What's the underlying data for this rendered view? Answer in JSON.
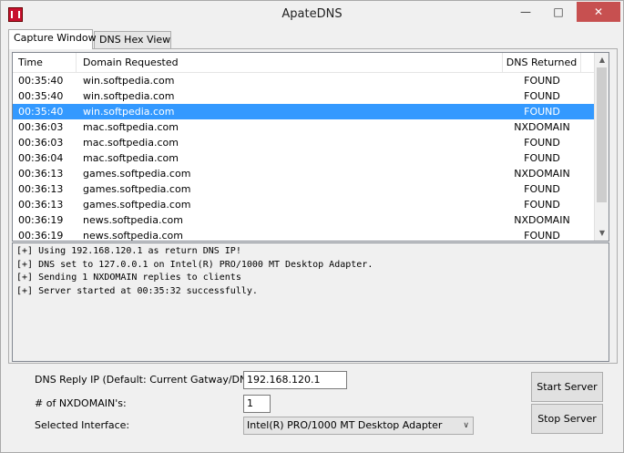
{
  "window": {
    "title": "ApateDNS"
  },
  "tabs": [
    {
      "label": "Capture Window",
      "active": true
    },
    {
      "label": "DNS Hex View",
      "active": false
    }
  ],
  "table": {
    "columns": [
      "Time",
      "Domain Requested",
      "DNS Returned"
    ],
    "rows": [
      {
        "time": "00:35:40",
        "domain": "win.softpedia.com",
        "returned": "FOUND",
        "selected": false
      },
      {
        "time": "00:35:40",
        "domain": "win.softpedia.com",
        "returned": "FOUND",
        "selected": false
      },
      {
        "time": "00:35:40",
        "domain": "win.softpedia.com",
        "returned": "FOUND",
        "selected": true
      },
      {
        "time": "00:36:03",
        "domain": "mac.softpedia.com",
        "returned": "NXDOMAIN",
        "selected": false
      },
      {
        "time": "00:36:03",
        "domain": "mac.softpedia.com",
        "returned": "FOUND",
        "selected": false
      },
      {
        "time": "00:36:04",
        "domain": "mac.softpedia.com",
        "returned": "FOUND",
        "selected": false
      },
      {
        "time": "00:36:13",
        "domain": "games.softpedia.com",
        "returned": "NXDOMAIN",
        "selected": false
      },
      {
        "time": "00:36:13",
        "domain": "games.softpedia.com",
        "returned": "FOUND",
        "selected": false
      },
      {
        "time": "00:36:13",
        "domain": "games.softpedia.com",
        "returned": "FOUND",
        "selected": false
      },
      {
        "time": "00:36:19",
        "domain": "news.softpedia.com",
        "returned": "NXDOMAIN",
        "selected": false
      },
      {
        "time": "00:36:19",
        "domain": "news.softpedia.com",
        "returned": "FOUND",
        "selected": false
      }
    ],
    "scroll": {
      "thumb_start": 0.0,
      "thumb_fraction": 0.85
    }
  },
  "log": [
    "[+] Using 192.168.120.1 as return DNS IP!",
    "[+] DNS set to 127.0.0.1 on Intel(R) PRO/1000 MT Desktop Adapter.",
    "[+] Sending 1 NXDOMAIN replies to clients",
    "[+] Server started at 00:35:32 successfully."
  ],
  "form": {
    "dns_reply_ip_label": "DNS Reply IP (Default: Current Gatway/DNS):",
    "dns_reply_ip_value": "192.168.120.1",
    "nxdomain_label": "# of NXDOMAIN's:",
    "nxdomain_value": "1",
    "interface_label": "Selected Interface:",
    "interface_value": "Intel(R) PRO/1000 MT Desktop Adapter"
  },
  "buttons": {
    "start": "Start Server",
    "stop": "Stop Server"
  },
  "icons": {
    "app": "apatedns-app-icon",
    "minimize": "minimize-icon",
    "maximize": "maximize-icon",
    "close": "close-icon"
  },
  "colors": {
    "selection": "#3399ff",
    "close_button": "#c75050",
    "app_icon": "#c8102e"
  }
}
